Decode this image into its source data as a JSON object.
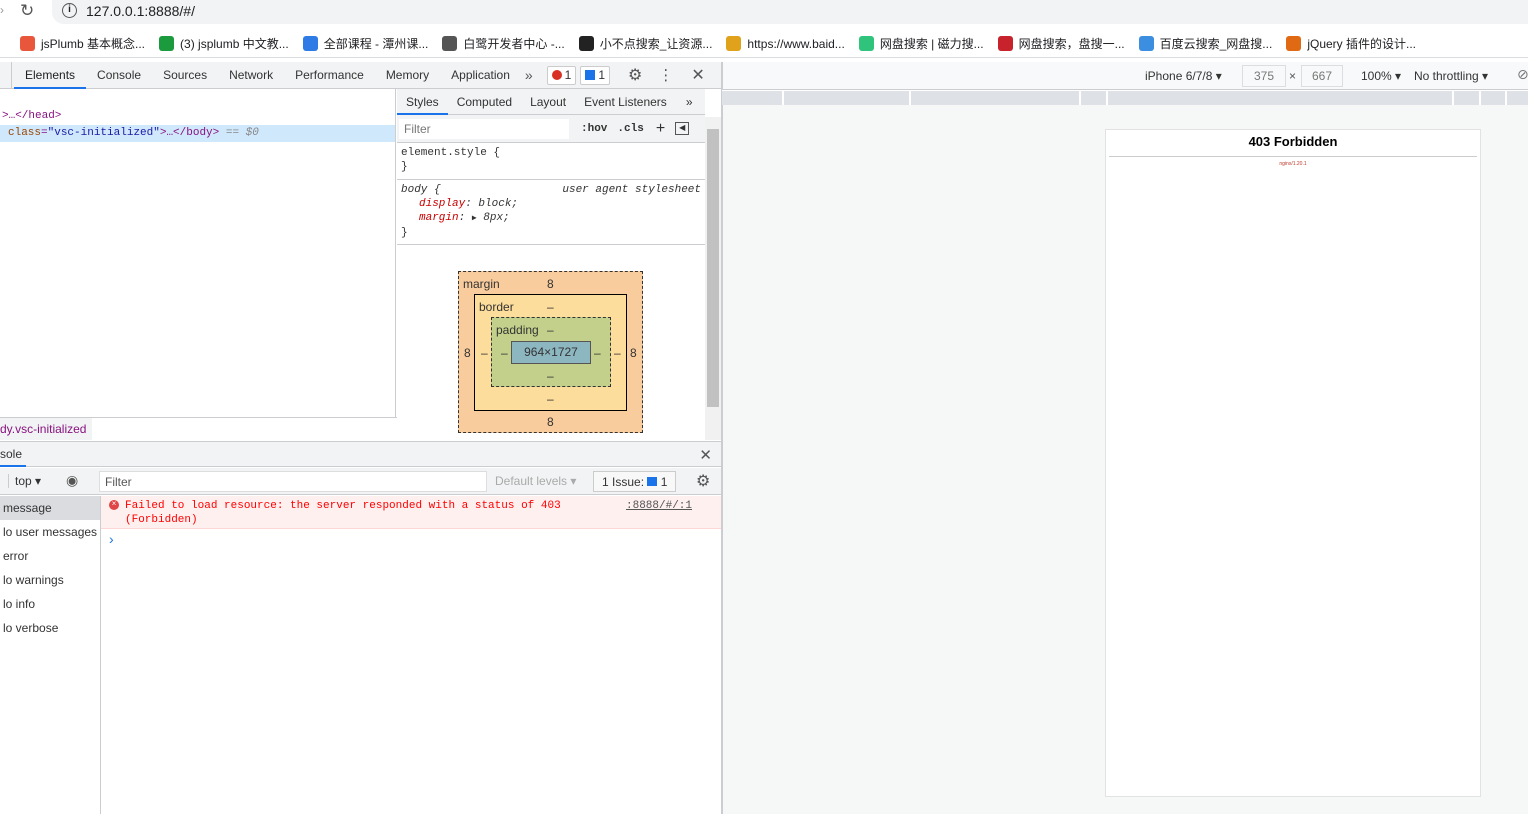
{
  "browser": {
    "url": "127.0.0.1:8888/#/",
    "bookmarks": [
      {
        "label": "jsPlumb 基本概念...",
        "icon": "jian-icon",
        "color": "#e8573b"
      },
      {
        "label": "(3) jsplumb 中文教...",
        "icon": "sf-icon",
        "color": "#1c9a3e"
      },
      {
        "label": "全部课程 - 潭州课...",
        "icon": "gear-logo-icon",
        "color": "#2e7be6"
      },
      {
        "label": "白鹭开发者中心 -...",
        "icon": "egret-icon",
        "color": "#555555"
      },
      {
        "label": "小不点搜索_让资源...",
        "icon": "penguin-icon",
        "color": "#222222"
      },
      {
        "label": "https://www.baid...",
        "icon": "chrome-icon",
        "color": "#e0a21b"
      },
      {
        "label": "网盘搜索 | 磁力搜...",
        "icon": "bag-icon",
        "color": "#2fc37b"
      },
      {
        "label": "网盘搜索，盘搜一...",
        "icon": "q-icon",
        "color": "#c8232c"
      },
      {
        "label": "百度云搜索_网盘搜...",
        "icon": "cloud-icon",
        "color": "#3b8ee0"
      },
      {
        "label": "jQuery 插件的设计...",
        "icon": "flower-icon",
        "color": "#e06a13"
      }
    ]
  },
  "devtools": {
    "tabs": [
      "Elements",
      "Console",
      "Sources",
      "Network",
      "Performance",
      "Memory",
      "Application"
    ],
    "active_tab": "Elements",
    "more": "»",
    "error_count": "1",
    "issue_count": "1",
    "dom": {
      "head_line": ">…</head>",
      "body_attr": "class",
      "body_val": "\"vsc-initialized\"",
      "body_rest": ">…</body>",
      "selected_marker": "== $0"
    },
    "breadcrumb": "dy.vsc-initialized",
    "styles": {
      "tabs": [
        "Styles",
        "Computed",
        "Layout",
        "Event Listeners"
      ],
      "filter_placeholder": "Filter",
      "hov": ":hov",
      "cls": ".cls",
      "element_style": "element.style {",
      "close": "}",
      "body_selector": "body {",
      "source": "user agent stylesheet",
      "props": [
        {
          "name": "display",
          "value": "block;"
        },
        {
          "name": "margin",
          "value": "8px;"
        }
      ]
    },
    "box_model": {
      "margin_label": "margin",
      "margin": "8",
      "border_label": "border",
      "border": "–",
      "padding_label": "padding",
      "padding": "–",
      "content": "964×1727"
    },
    "console": {
      "title": "sole",
      "context": "top",
      "filter_placeholder": "Filter",
      "levels": "Default levels",
      "issues_label": "1 Issue:",
      "issues_count": "1",
      "sidebar": [
        "message",
        "lo user messages",
        "error",
        "lo warnings",
        "lo info",
        "lo verbose"
      ],
      "error_message": "Failed to load resource: the server responded with a status of 403 (Forbidden)",
      "error_source": ":8888/#/:1",
      "prompt": "›"
    }
  },
  "device": {
    "model": "iPhone 6/7/8",
    "width": "375",
    "x": "×",
    "height": "667",
    "zoom": "100%",
    "throttling": "No throttling"
  },
  "page": {
    "title": "403 Forbidden",
    "server": "nginx/1.20.1"
  }
}
